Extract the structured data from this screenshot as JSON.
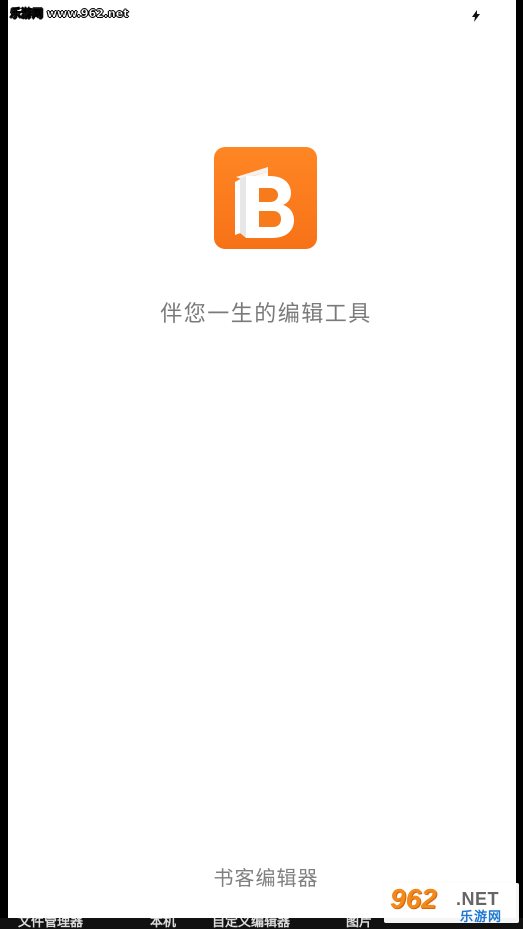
{
  "watermark": {
    "top_text": "乐游网 www.962.net",
    "bottom_num": "962",
    "bottom_net": ".NET",
    "bottom_cn": "乐游网"
  },
  "status_bar": {
    "icon_name": "lightning-icon"
  },
  "splash": {
    "logo_icon": "book-b-logo-icon",
    "accent": "#F77A1B",
    "slogan": "伴您一生的编辑工具",
    "app_name": "书客编辑器"
  },
  "bottom_nav_preview": {
    "items": [
      "文件管理器",
      "本机",
      "自定义编辑器",
      "图片"
    ]
  }
}
